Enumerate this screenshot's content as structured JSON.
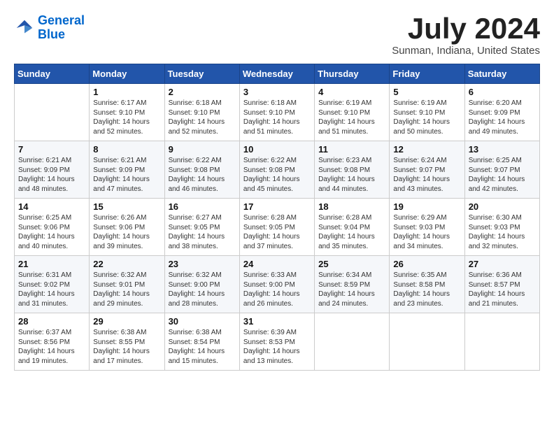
{
  "header": {
    "logo_line1": "General",
    "logo_line2": "Blue",
    "month_title": "July 2024",
    "location": "Sunman, Indiana, United States"
  },
  "weekdays": [
    "Sunday",
    "Monday",
    "Tuesday",
    "Wednesday",
    "Thursday",
    "Friday",
    "Saturday"
  ],
  "weeks": [
    [
      {
        "day": "",
        "sunrise": "",
        "sunset": "",
        "daylight": ""
      },
      {
        "day": "1",
        "sunrise": "Sunrise: 6:17 AM",
        "sunset": "Sunset: 9:10 PM",
        "daylight": "Daylight: 14 hours and 52 minutes."
      },
      {
        "day": "2",
        "sunrise": "Sunrise: 6:18 AM",
        "sunset": "Sunset: 9:10 PM",
        "daylight": "Daylight: 14 hours and 52 minutes."
      },
      {
        "day": "3",
        "sunrise": "Sunrise: 6:18 AM",
        "sunset": "Sunset: 9:10 PM",
        "daylight": "Daylight: 14 hours and 51 minutes."
      },
      {
        "day": "4",
        "sunrise": "Sunrise: 6:19 AM",
        "sunset": "Sunset: 9:10 PM",
        "daylight": "Daylight: 14 hours and 51 minutes."
      },
      {
        "day": "5",
        "sunrise": "Sunrise: 6:19 AM",
        "sunset": "Sunset: 9:10 PM",
        "daylight": "Daylight: 14 hours and 50 minutes."
      },
      {
        "day": "6",
        "sunrise": "Sunrise: 6:20 AM",
        "sunset": "Sunset: 9:09 PM",
        "daylight": "Daylight: 14 hours and 49 minutes."
      }
    ],
    [
      {
        "day": "7",
        "sunrise": "Sunrise: 6:21 AM",
        "sunset": "Sunset: 9:09 PM",
        "daylight": "Daylight: 14 hours and 48 minutes."
      },
      {
        "day": "8",
        "sunrise": "Sunrise: 6:21 AM",
        "sunset": "Sunset: 9:09 PM",
        "daylight": "Daylight: 14 hours and 47 minutes."
      },
      {
        "day": "9",
        "sunrise": "Sunrise: 6:22 AM",
        "sunset": "Sunset: 9:08 PM",
        "daylight": "Daylight: 14 hours and 46 minutes."
      },
      {
        "day": "10",
        "sunrise": "Sunrise: 6:22 AM",
        "sunset": "Sunset: 9:08 PM",
        "daylight": "Daylight: 14 hours and 45 minutes."
      },
      {
        "day": "11",
        "sunrise": "Sunrise: 6:23 AM",
        "sunset": "Sunset: 9:08 PM",
        "daylight": "Daylight: 14 hours and 44 minutes."
      },
      {
        "day": "12",
        "sunrise": "Sunrise: 6:24 AM",
        "sunset": "Sunset: 9:07 PM",
        "daylight": "Daylight: 14 hours and 43 minutes."
      },
      {
        "day": "13",
        "sunrise": "Sunrise: 6:25 AM",
        "sunset": "Sunset: 9:07 PM",
        "daylight": "Daylight: 14 hours and 42 minutes."
      }
    ],
    [
      {
        "day": "14",
        "sunrise": "Sunrise: 6:25 AM",
        "sunset": "Sunset: 9:06 PM",
        "daylight": "Daylight: 14 hours and 40 minutes."
      },
      {
        "day": "15",
        "sunrise": "Sunrise: 6:26 AM",
        "sunset": "Sunset: 9:06 PM",
        "daylight": "Daylight: 14 hours and 39 minutes."
      },
      {
        "day": "16",
        "sunrise": "Sunrise: 6:27 AM",
        "sunset": "Sunset: 9:05 PM",
        "daylight": "Daylight: 14 hours and 38 minutes."
      },
      {
        "day": "17",
        "sunrise": "Sunrise: 6:28 AM",
        "sunset": "Sunset: 9:05 PM",
        "daylight": "Daylight: 14 hours and 37 minutes."
      },
      {
        "day": "18",
        "sunrise": "Sunrise: 6:28 AM",
        "sunset": "Sunset: 9:04 PM",
        "daylight": "Daylight: 14 hours and 35 minutes."
      },
      {
        "day": "19",
        "sunrise": "Sunrise: 6:29 AM",
        "sunset": "Sunset: 9:03 PM",
        "daylight": "Daylight: 14 hours and 34 minutes."
      },
      {
        "day": "20",
        "sunrise": "Sunrise: 6:30 AM",
        "sunset": "Sunset: 9:03 PM",
        "daylight": "Daylight: 14 hours and 32 minutes."
      }
    ],
    [
      {
        "day": "21",
        "sunrise": "Sunrise: 6:31 AM",
        "sunset": "Sunset: 9:02 PM",
        "daylight": "Daylight: 14 hours and 31 minutes."
      },
      {
        "day": "22",
        "sunrise": "Sunrise: 6:32 AM",
        "sunset": "Sunset: 9:01 PM",
        "daylight": "Daylight: 14 hours and 29 minutes."
      },
      {
        "day": "23",
        "sunrise": "Sunrise: 6:32 AM",
        "sunset": "Sunset: 9:00 PM",
        "daylight": "Daylight: 14 hours and 28 minutes."
      },
      {
        "day": "24",
        "sunrise": "Sunrise: 6:33 AM",
        "sunset": "Sunset: 9:00 PM",
        "daylight": "Daylight: 14 hours and 26 minutes."
      },
      {
        "day": "25",
        "sunrise": "Sunrise: 6:34 AM",
        "sunset": "Sunset: 8:59 PM",
        "daylight": "Daylight: 14 hours and 24 minutes."
      },
      {
        "day": "26",
        "sunrise": "Sunrise: 6:35 AM",
        "sunset": "Sunset: 8:58 PM",
        "daylight": "Daylight: 14 hours and 23 minutes."
      },
      {
        "day": "27",
        "sunrise": "Sunrise: 6:36 AM",
        "sunset": "Sunset: 8:57 PM",
        "daylight": "Daylight: 14 hours and 21 minutes."
      }
    ],
    [
      {
        "day": "28",
        "sunrise": "Sunrise: 6:37 AM",
        "sunset": "Sunset: 8:56 PM",
        "daylight": "Daylight: 14 hours and 19 minutes."
      },
      {
        "day": "29",
        "sunrise": "Sunrise: 6:38 AM",
        "sunset": "Sunset: 8:55 PM",
        "daylight": "Daylight: 14 hours and 17 minutes."
      },
      {
        "day": "30",
        "sunrise": "Sunrise: 6:38 AM",
        "sunset": "Sunset: 8:54 PM",
        "daylight": "Daylight: 14 hours and 15 minutes."
      },
      {
        "day": "31",
        "sunrise": "Sunrise: 6:39 AM",
        "sunset": "Sunset: 8:53 PM",
        "daylight": "Daylight: 14 hours and 13 minutes."
      },
      {
        "day": "",
        "sunrise": "",
        "sunset": "",
        "daylight": ""
      },
      {
        "day": "",
        "sunrise": "",
        "sunset": "",
        "daylight": ""
      },
      {
        "day": "",
        "sunrise": "",
        "sunset": "",
        "daylight": ""
      }
    ]
  ]
}
